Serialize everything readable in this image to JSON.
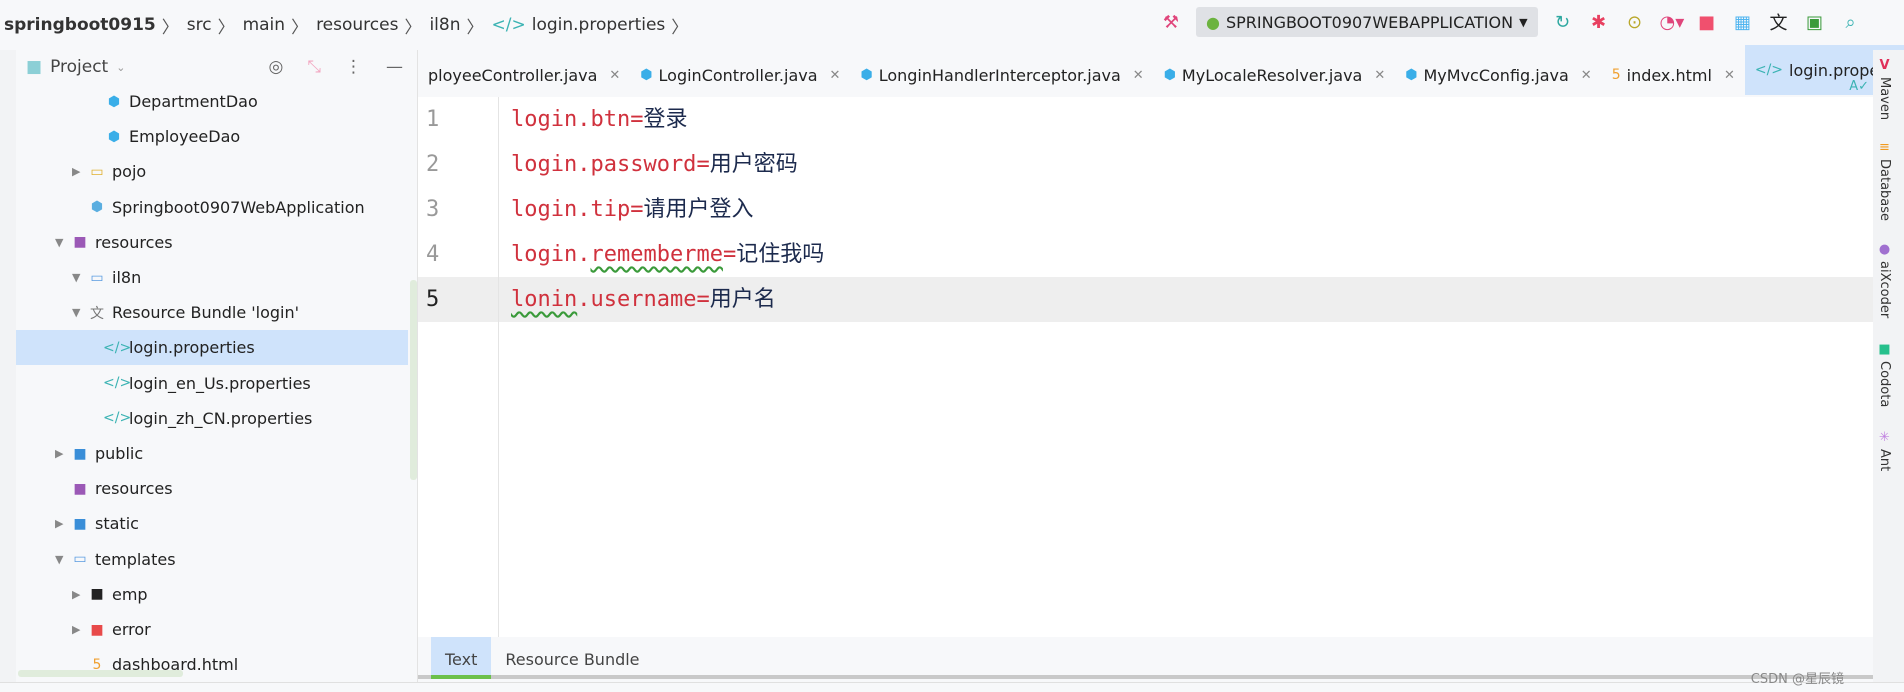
{
  "breadcrumb": [
    "springboot0915",
    "src",
    "main",
    "resources",
    "il8n",
    "login.properties"
  ],
  "toolbar": {
    "run_config": "SPRINGBOOT0907WEBAPPLICATION"
  },
  "project": {
    "title": "Project",
    "items": [
      {
        "label": "DepartmentDao",
        "indent": 3,
        "icon": "class-icon",
        "arrow": ""
      },
      {
        "label": "EmployeeDao",
        "indent": 3,
        "icon": "class-icon",
        "arrow": ""
      },
      {
        "label": "pojo",
        "indent": 2,
        "icon": "package-icon",
        "arrow": "▶"
      },
      {
        "label": "Springboot0907WebApplication",
        "indent": 2,
        "icon": "spring-class-icon",
        "arrow": ""
      },
      {
        "label": "resources",
        "indent": 1,
        "icon": "resources-folder-icon",
        "arrow": "▼"
      },
      {
        "label": "il8n",
        "indent": 2,
        "icon": "folder-icon",
        "arrow": "▼"
      },
      {
        "label": "Resource Bundle 'login'",
        "indent": 2,
        "icon": "resource-bundle-icon",
        "arrow": "▼",
        "extra": 1
      },
      {
        "label": "login.properties",
        "indent": 3,
        "icon": "properties-icon",
        "arrow": "",
        "selected": true
      },
      {
        "label": "login_en_Us.properties",
        "indent": 3,
        "icon": "properties-icon",
        "arrow": ""
      },
      {
        "label": "login_zh_CN.properties",
        "indent": 3,
        "icon": "properties-icon",
        "arrow": ""
      },
      {
        "label": "public",
        "indent": 1,
        "icon": "web-folder-icon",
        "arrow": "▶"
      },
      {
        "label": "resources",
        "indent": 1,
        "icon": "resources-folder-icon",
        "arrow": ""
      },
      {
        "label": "static",
        "indent": 1,
        "icon": "web-folder-icon",
        "arrow": "▶"
      },
      {
        "label": "templates",
        "indent": 1,
        "icon": "folder-icon",
        "arrow": "▼"
      },
      {
        "label": "emp",
        "indent": 2,
        "icon": "dark-folder-icon",
        "arrow": "▶"
      },
      {
        "label": "error",
        "indent": 2,
        "icon": "error-folder-icon",
        "arrow": "▶"
      },
      {
        "label": "dashboard.html",
        "indent": 2,
        "icon": "html-icon",
        "arrow": ""
      }
    ]
  },
  "tabs": [
    {
      "label": "ployeeController.java",
      "icon": ""
    },
    {
      "label": "LoginController.java",
      "icon": "class-icon"
    },
    {
      "label": "LonginHandlerInterceptor.java",
      "icon": "class-icon"
    },
    {
      "label": "MyLocaleResolver.java",
      "icon": "class-icon"
    },
    {
      "label": "MyMvcConfig.java",
      "icon": "class-icon"
    },
    {
      "label": "index.html",
      "icon": "html-icon"
    },
    {
      "label": "login.properties",
      "icon": "properties-icon",
      "active": true
    }
  ],
  "editor": {
    "lines": [
      {
        "n": "1",
        "key": "login.btn",
        "eq": "=",
        "value": "登录"
      },
      {
        "n": "2",
        "key": "login.password",
        "eq": "=",
        "value": "用户密码"
      },
      {
        "n": "3",
        "key": "login.tip",
        "eq": "=",
        "value": "请用户登入"
      },
      {
        "n": "4",
        "key_a": "login.",
        "key_b": "rememberme",
        "eq": "=",
        "value": "记住我吗"
      },
      {
        "n": "5",
        "key_a": "lonin",
        "key_b": ".username",
        "eq": "=",
        "value": "用户名"
      }
    ]
  },
  "bottom_tabs": [
    "Text",
    "Resource Bundle"
  ],
  "right_tools": [
    "Maven",
    "Database",
    "aiXcoder",
    "Codota",
    "Ant"
  ],
  "watermark": "CSDN @星辰镜"
}
